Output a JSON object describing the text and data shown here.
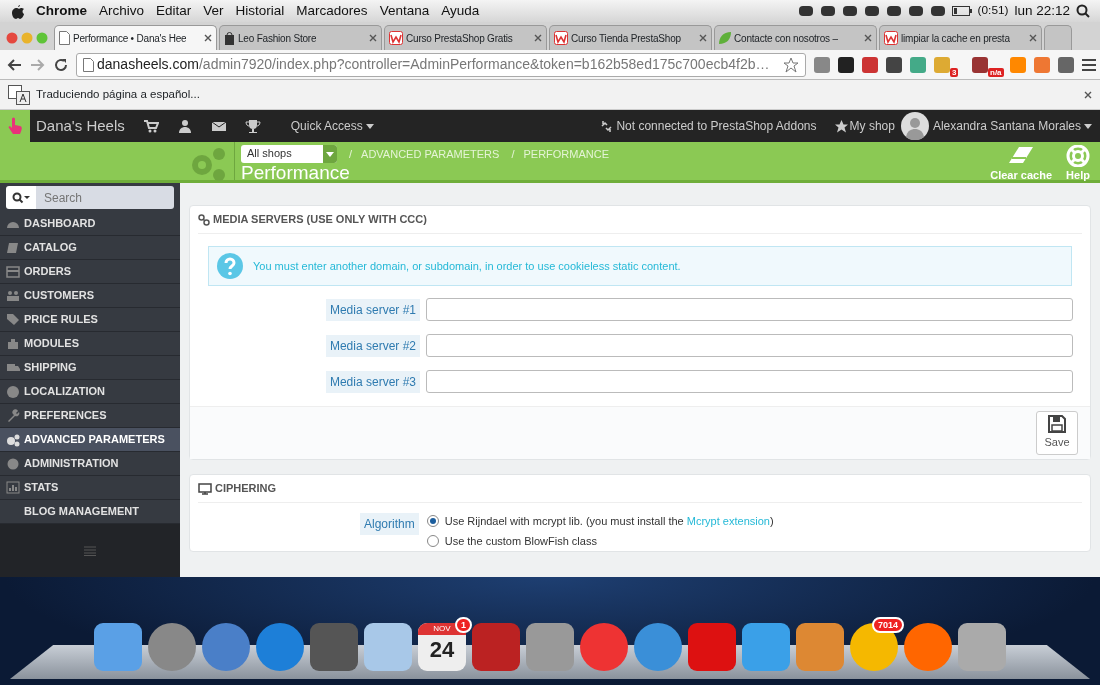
{
  "menubar": {
    "app": "Chrome",
    "menus": [
      "Archivo",
      "Editar",
      "Ver",
      "Historial",
      "Marcadores",
      "Ventana",
      "Ayuda"
    ],
    "battery": "(0:51)",
    "clock": "lun 22:12"
  },
  "browser_tabs": [
    {
      "title": "Performance • Dana's Hee",
      "kind": "page",
      "selected": true
    },
    {
      "title": "Leo Fashion Store",
      "kind": "bag",
      "selected": false
    },
    {
      "title": "Curso PrestaShop Gratis",
      "kind": "w",
      "selected": false
    },
    {
      "title": "Curso Tienda PrestaShop",
      "kind": "w",
      "selected": false
    },
    {
      "title": "Contacte con nosotros –",
      "kind": "leaf",
      "selected": false
    },
    {
      "title": "limpiar la cache en presta",
      "kind": "w",
      "selected": false
    }
  ],
  "address_bar": {
    "host": "danasheels.com",
    "path": "/admin7920/index.php?controller=AdminPerformance&token=b162b58ed175c700ecb4f2b…"
  },
  "extension_badges": [
    "3",
    "n/a"
  ],
  "translate_bar": {
    "message": "Traduciendo página a español..."
  },
  "admin_header": {
    "shop_name": "Dana's Heels",
    "quick_access": "Quick Access",
    "addons_status": "Not connected to PrestaShop Addons",
    "my_shop": "My shop",
    "employee": "Alexandra Santana Morales"
  },
  "page_header": {
    "shop_select": "All shops",
    "separator": "/",
    "breadcrumb": [
      "ADVANCED PARAMETERS",
      "PERFORMANCE"
    ],
    "title": "Performance",
    "actions": [
      {
        "label": "Clear cache",
        "kind": "eraser"
      },
      {
        "label": "Help",
        "kind": "lifebuoy"
      }
    ]
  },
  "sidebar": {
    "search_placeholder": "Search",
    "items": [
      {
        "label": "DASHBOARD",
        "selected": false
      },
      {
        "label": "CATALOG",
        "selected": false
      },
      {
        "label": "ORDERS",
        "selected": false
      },
      {
        "label": "CUSTOMERS",
        "selected": false
      },
      {
        "label": "PRICE RULES",
        "selected": false
      },
      {
        "label": "MODULES",
        "selected": false
      },
      {
        "label": "SHIPPING",
        "selected": false
      },
      {
        "label": "LOCALIZATION",
        "selected": false
      },
      {
        "label": "PREFERENCES",
        "selected": false
      },
      {
        "label": "ADVANCED PARAMETERS",
        "selected": true
      },
      {
        "label": "ADMINISTRATION",
        "selected": false
      },
      {
        "label": "STATS",
        "selected": false
      },
      {
        "label": "BLOG MANAGEMENT",
        "selected": false
      }
    ]
  },
  "media_servers": {
    "title": "MEDIA SERVERS (USE ONLY WITH CCC)",
    "alert": "You must enter another domain, or subdomain, in order to use cookieless static content.",
    "fields": [
      {
        "label": "Media server #1"
      },
      {
        "label": "Media server #2"
      },
      {
        "label": "Media server #3"
      }
    ],
    "save": "Save"
  },
  "ciphering": {
    "title": "CIPHERING",
    "label": "Algorithm",
    "options": [
      {
        "text": "Use Rijndael with mcrypt lib. (you must install the ",
        "link": "Mcrypt extension",
        "after": ")",
        "selected": true
      },
      {
        "text": "Use the custom BlowFish class",
        "selected": false
      }
    ]
  },
  "dock": {
    "calendar_month": "NOV",
    "calendar_day": "24",
    "calendar_badge": "1",
    "mail_badge": "7014"
  }
}
